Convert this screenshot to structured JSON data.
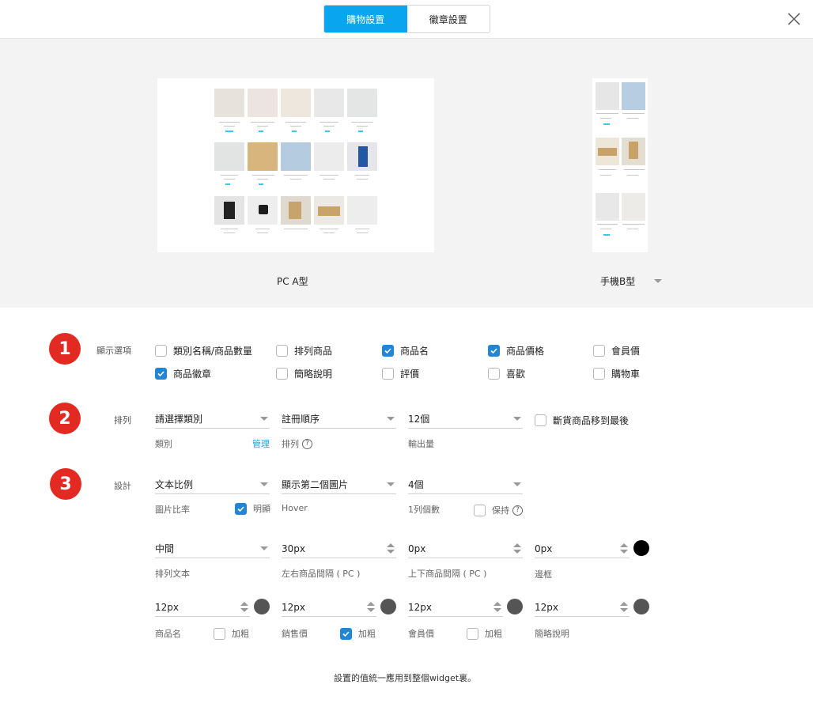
{
  "tabs": [
    {
      "label": "購物設置",
      "active": true
    },
    {
      "label": "徽章設置",
      "active": false
    }
  ],
  "preview": {
    "pc_label": "PC A型",
    "mobile_label": "手機B型"
  },
  "section1": {
    "number": "1",
    "label": "顯示選項",
    "options": [
      {
        "label": "類別名稱/商品數量",
        "checked": false
      },
      {
        "label": "排列商品",
        "checked": false
      },
      {
        "label": "商品名",
        "checked": true
      },
      {
        "label": "商品價格",
        "checked": true
      },
      {
        "label": "會員價",
        "checked": false
      },
      {
        "label": "商品徽章",
        "checked": true
      },
      {
        "label": "簡略說明",
        "checked": false
      },
      {
        "label": "評價",
        "checked": false
      },
      {
        "label": "喜歡",
        "checked": false
      },
      {
        "label": "購物車",
        "checked": false
      }
    ]
  },
  "section2": {
    "number": "2",
    "label": "排列",
    "category": {
      "value": "請選擇類別",
      "sub": "類別",
      "link": "管理"
    },
    "sort": {
      "value": "註冊順序",
      "sub": "排列"
    },
    "count": {
      "value": "12個",
      "sub": "輸出量"
    },
    "soldout": {
      "label": "斷貨商品移到最後",
      "checked": false
    }
  },
  "section3": {
    "number": "3",
    "label": "設計",
    "ratio": {
      "value": "文本比例",
      "sub": "圖片比率",
      "check_label": "明顯",
      "checked": true
    },
    "hover": {
      "value": "顯示第二個圖片",
      "sub": "Hover"
    },
    "per_row": {
      "value": "4個",
      "sub": "1列個數",
      "check_label": "保持",
      "checked": false
    },
    "align": {
      "value": "中間",
      "sub": "排列文本"
    },
    "h_gap": {
      "value": "30px",
      "sub": "左右商品間隔 ( PC )"
    },
    "v_gap": {
      "value": "0px",
      "sub": "上下商品間隔 ( PC )"
    },
    "border": {
      "value": "0px",
      "sub": "邊框",
      "color": "#000000"
    },
    "name_size": {
      "value": "12px",
      "sub": "商品名",
      "bold_label": "加粗",
      "bold": false,
      "color": "#555555"
    },
    "price_size": {
      "value": "12px",
      "sub": "銷售價",
      "bold_label": "加粗",
      "bold": true,
      "color": "#555555"
    },
    "member_size": {
      "value": "12px",
      "sub": "會員價",
      "bold_label": "加粗",
      "bold": false,
      "color": "#555555"
    },
    "desc_size": {
      "value": "12px",
      "sub": "簡略說明",
      "color": "#555555"
    }
  },
  "footer": "設置的值統一應用到整個widget裏。",
  "colors": {
    "accent": "#0aa5ef",
    "badge": "#e32a22",
    "checkbox": "#2185d8"
  }
}
